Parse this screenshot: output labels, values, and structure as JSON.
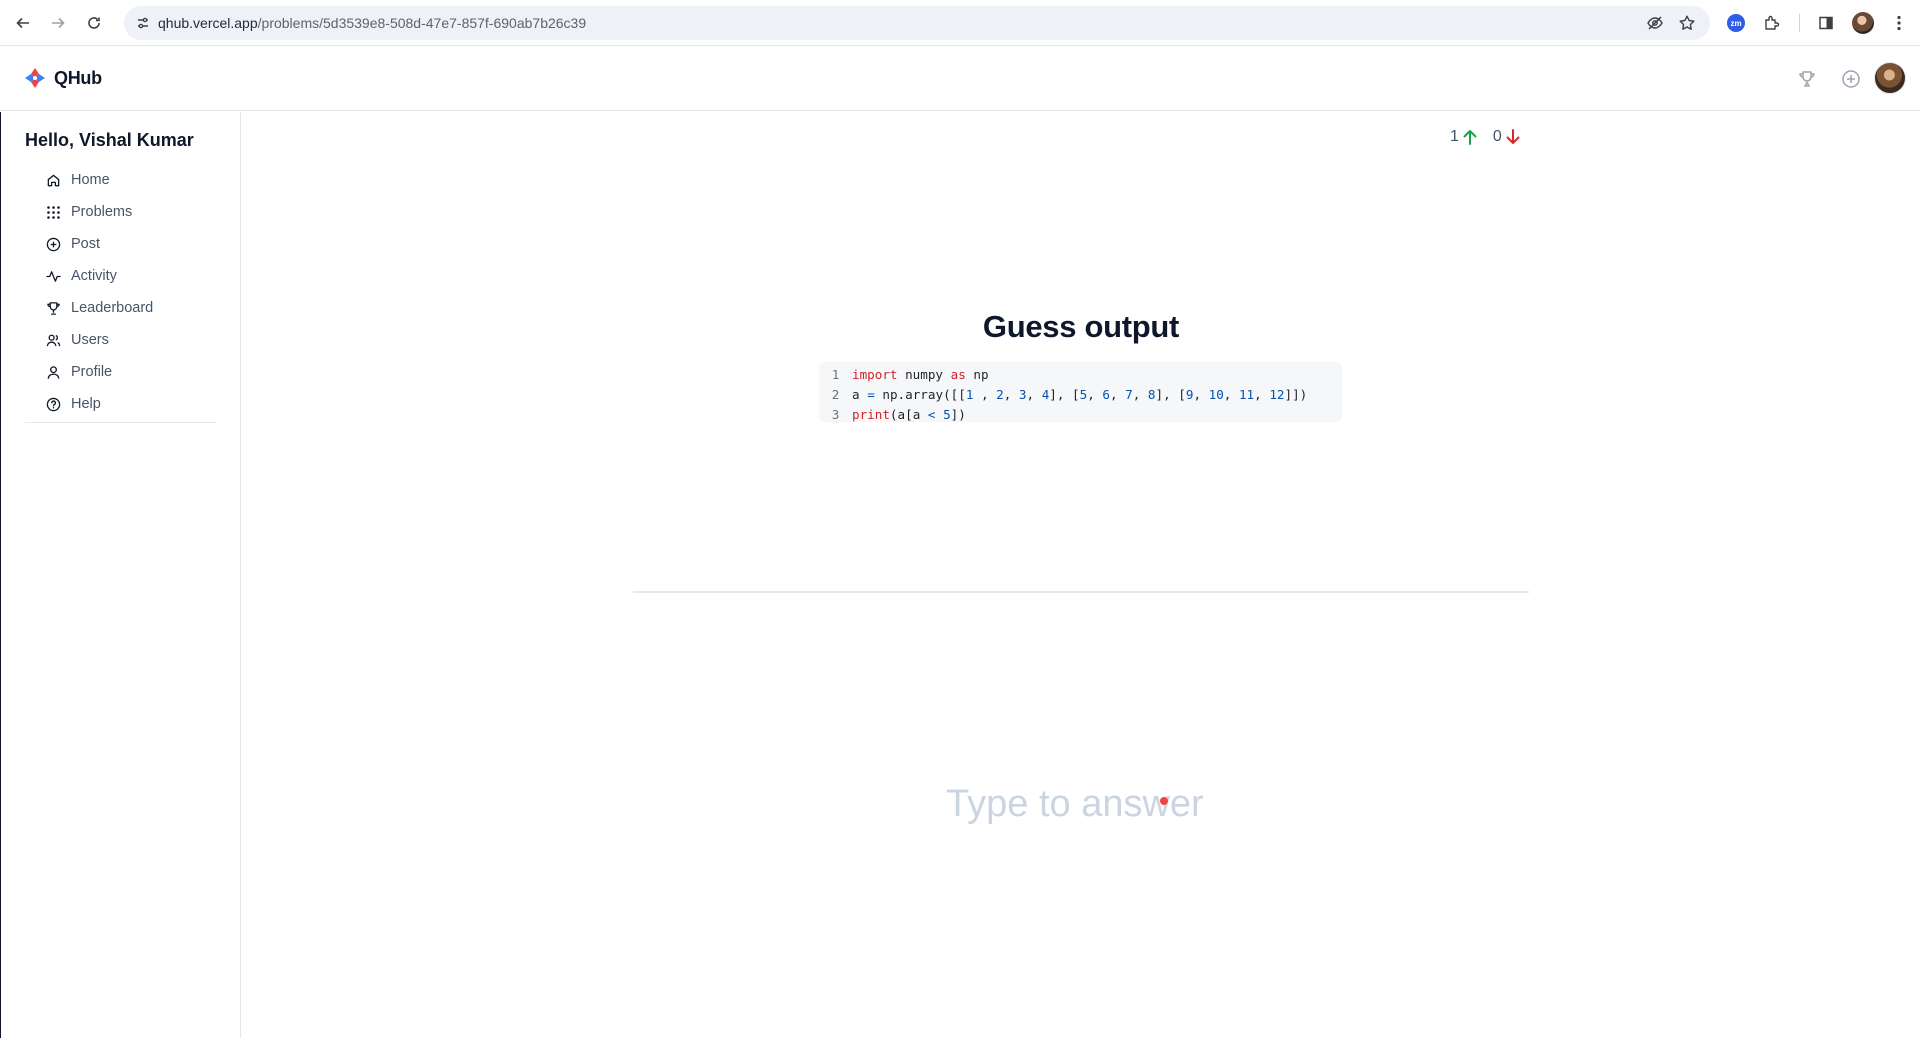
{
  "browser": {
    "url_host": "qhub.vercel.app",
    "url_path": "/problems/5d3539e8-508d-47e7-857f-690ab7b26c39",
    "extension_zoom_label": "zm"
  },
  "header": {
    "brand": "QHub"
  },
  "sidebar": {
    "greeting": "Hello, Vishal Kumar",
    "items": [
      {
        "label": "Home",
        "icon": "home-icon"
      },
      {
        "label": "Problems",
        "icon": "grid-icon"
      },
      {
        "label": "Post",
        "icon": "plus-circle-icon"
      },
      {
        "label": "Activity",
        "icon": "activity-icon"
      },
      {
        "label": "Leaderboard",
        "icon": "trophy-icon"
      },
      {
        "label": "Users",
        "icon": "users-icon"
      },
      {
        "label": "Profile",
        "icon": "user-icon"
      },
      {
        "label": "Help",
        "icon": "help-circle-icon"
      }
    ]
  },
  "votes": {
    "up": "1",
    "down": "0",
    "up_color": "#16a34a",
    "down_color": "#dc2626"
  },
  "problem": {
    "title": "Guess output",
    "code_lines": [
      {
        "n": "1",
        "text": "import numpy as np"
      },
      {
        "n": "2",
        "text": "a = np.array([[1 , 2, 3, 4], [5, 6, 7, 8], [9, 10, 11, 12]])"
      },
      {
        "n": "3",
        "text": "print(a[a < 5])"
      }
    ]
  },
  "answer": {
    "placeholder": "Type to answer",
    "value": ""
  }
}
